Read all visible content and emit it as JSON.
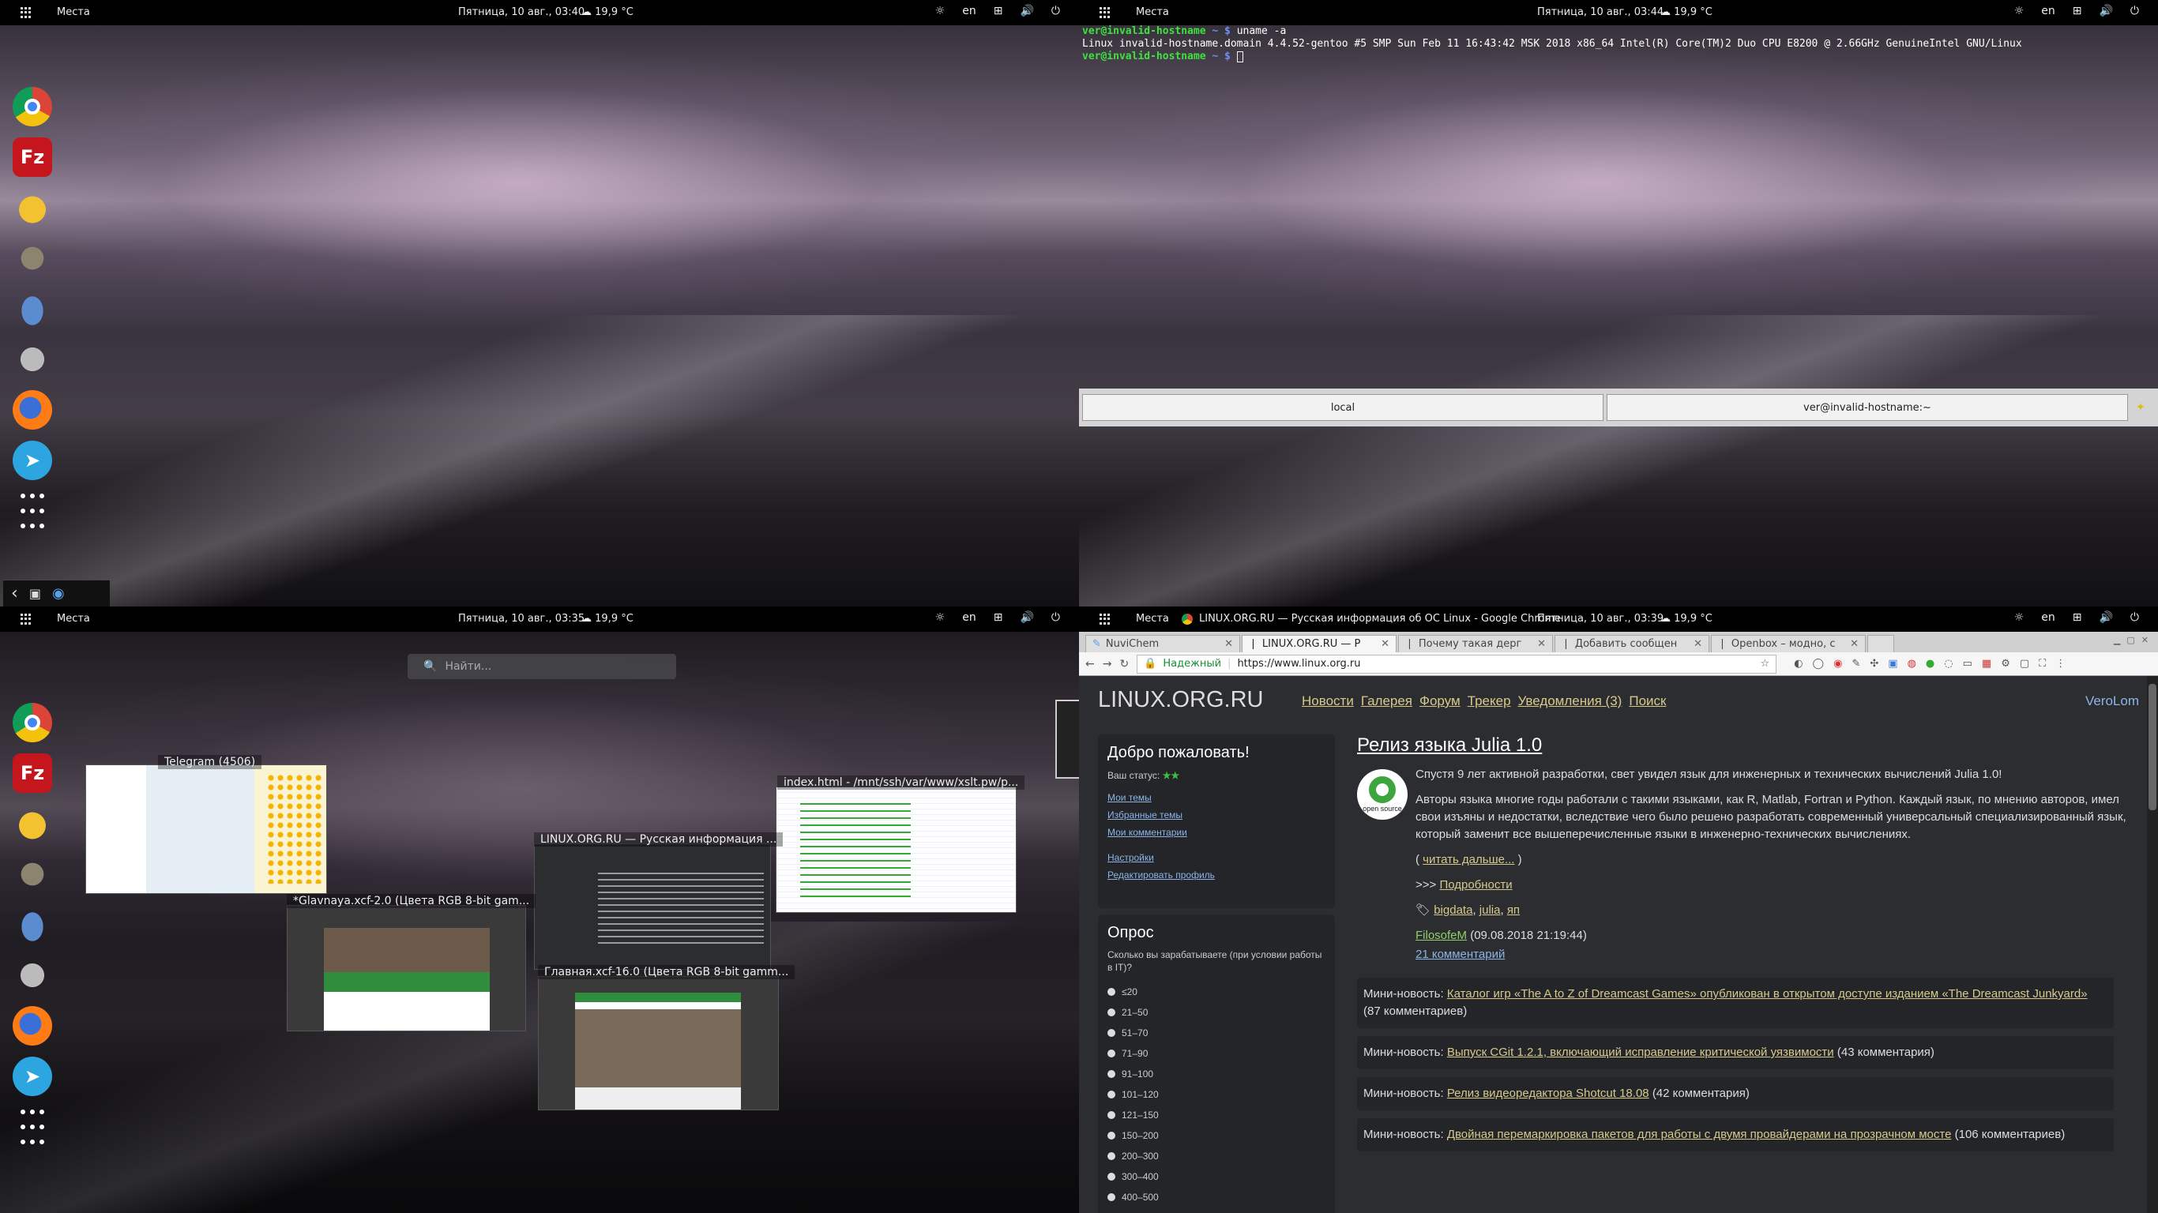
{
  "panel": {
    "places": "Места",
    "weather": "19,9 °C",
    "lang": "en",
    "clocks": {
      "tl": "Пятница, 10 авг., 03:40",
      "tr": "Пятница, 10 авг., 03:44",
      "bl": "Пятница, 10 авг., 03:35",
      "br": "Пятница, 10 авг., 03:39"
    },
    "chrome_title": "LINUX.ORG.RU — Русская информация об ОС Linux - Google Chrome"
  },
  "dock": [
    "chrome-icon",
    "filezilla-icon",
    "teapot-icon",
    "gimp-icon",
    "drop-icon",
    "preferences-icon",
    "firefox-icon",
    "telegram-icon",
    "app-grid-icon"
  ],
  "terminal": {
    "line1_prompt": "ver@invalid-hostname",
    "line1_path": "~ $",
    "line1_cmd": "uname -a",
    "line2": "Linux invalid-hostname.domain 4.4.52-gentoo #5 SMP Sun Feb 11 16:43:42 MSK 2018 x86_64 Intel(R) Core(TM)2 Duo CPU E8200 @ 2.66GHz GenuineIntel GNU/Linux",
    "line3_prompt": "ver@invalid-hostname",
    "line3_path": "~ $",
    "tabs": [
      "local",
      "ver@invalid-hostname:~"
    ]
  },
  "overview": {
    "search_placeholder": "Найти...",
    "windows": [
      "Telegram (4506)",
      "index.html - /mnt/ssh/var/www/xslt.pw/p...",
      "LINUX.ORG.RU — Русская информация ...",
      "*Glavnaya.xcf-2.0 (Цвета RGB 8-bit gam...",
      "Главная.xcf-16.0 (Цвета RGB 8-bit gamm..."
    ]
  },
  "browser": {
    "tabs": [
      "NuviChem",
      "LINUX.ORG.RU — Р",
      "Почему такая дерг",
      "Добавить сообщен",
      "Openbox – модно, с"
    ],
    "secure": "Надежный",
    "url": "https://www.linux.org.ru",
    "logo": "LINUX.ORG.RU",
    "nav": [
      "Новости",
      "Галерея",
      "Форум",
      "Трекер",
      "Уведомления (3)",
      "Поиск"
    ],
    "user": "VeroLom",
    "welcome": {
      "title": "Добро пожаловать!",
      "status_label": "Ваш статус:",
      "stars": "★★",
      "links1": [
        "Мои темы",
        "Избранные темы",
        "Мои комментарии"
      ],
      "links2": [
        "Настройки",
        "Редактировать профиль"
      ]
    },
    "poll": {
      "title": "Опрос",
      "question": "Сколько вы зарабатываете (при условии работы в IT)?",
      "options": [
        "≤20",
        "21–50",
        "51–70",
        "71–90",
        "91–100",
        "101–120",
        "121–150",
        "150–200",
        "200–300",
        "300–400",
        "400–500"
      ]
    },
    "article": {
      "title": "Релиз языка Julia 1.0",
      "badge": "open source",
      "p1": "Спустя 9 лет активной разработки, свет увидел язык для инженерных и технических вычислений Julia 1.0!",
      "p2": "Авторы языка многие годы работали с такими языками, как R, Matlab, Fortran и Python. Каждый язык, по мнению авторов, имел свои изъяны и недостатки, вследствие чего было решено разработать современный универсальный специализированный язык, который заменит все вышеперечисленные языки в инженерно-технических вычислениях.",
      "readmore": "читать дальше...",
      "more_prefix": ">>>",
      "more": "Подробности",
      "tags": [
        "bigdata",
        "julia",
        "яп"
      ],
      "author": "FilosofeM",
      "date": "(09.08.2018 21:19:44)",
      "comments": "21 комментарий"
    },
    "mini": [
      {
        "prefix": "Мини-новость:",
        "link": "Каталог игр «The A to Z of Dreamcast Games» опубликован в открытом доступе изданием «The Dreamcast Junkyard»",
        "count": "(87 комментариев)"
      },
      {
        "prefix": "Мини-новость:",
        "link": "Выпуск CGit 1.2.1, включающий исправление критической уязвимости",
        "count": "(43 комментария)"
      },
      {
        "prefix": "Мини-новость:",
        "link": "Релиз видеоредактора Shotcut 18.08",
        "count": "(42 комментария)"
      },
      {
        "prefix": "Мини-новость:",
        "link": "Двойная перемаркировка пакетов для работы с двумя провайдерами на прозрачном мосте",
        "count": "(106 комментариев)"
      }
    ]
  }
}
